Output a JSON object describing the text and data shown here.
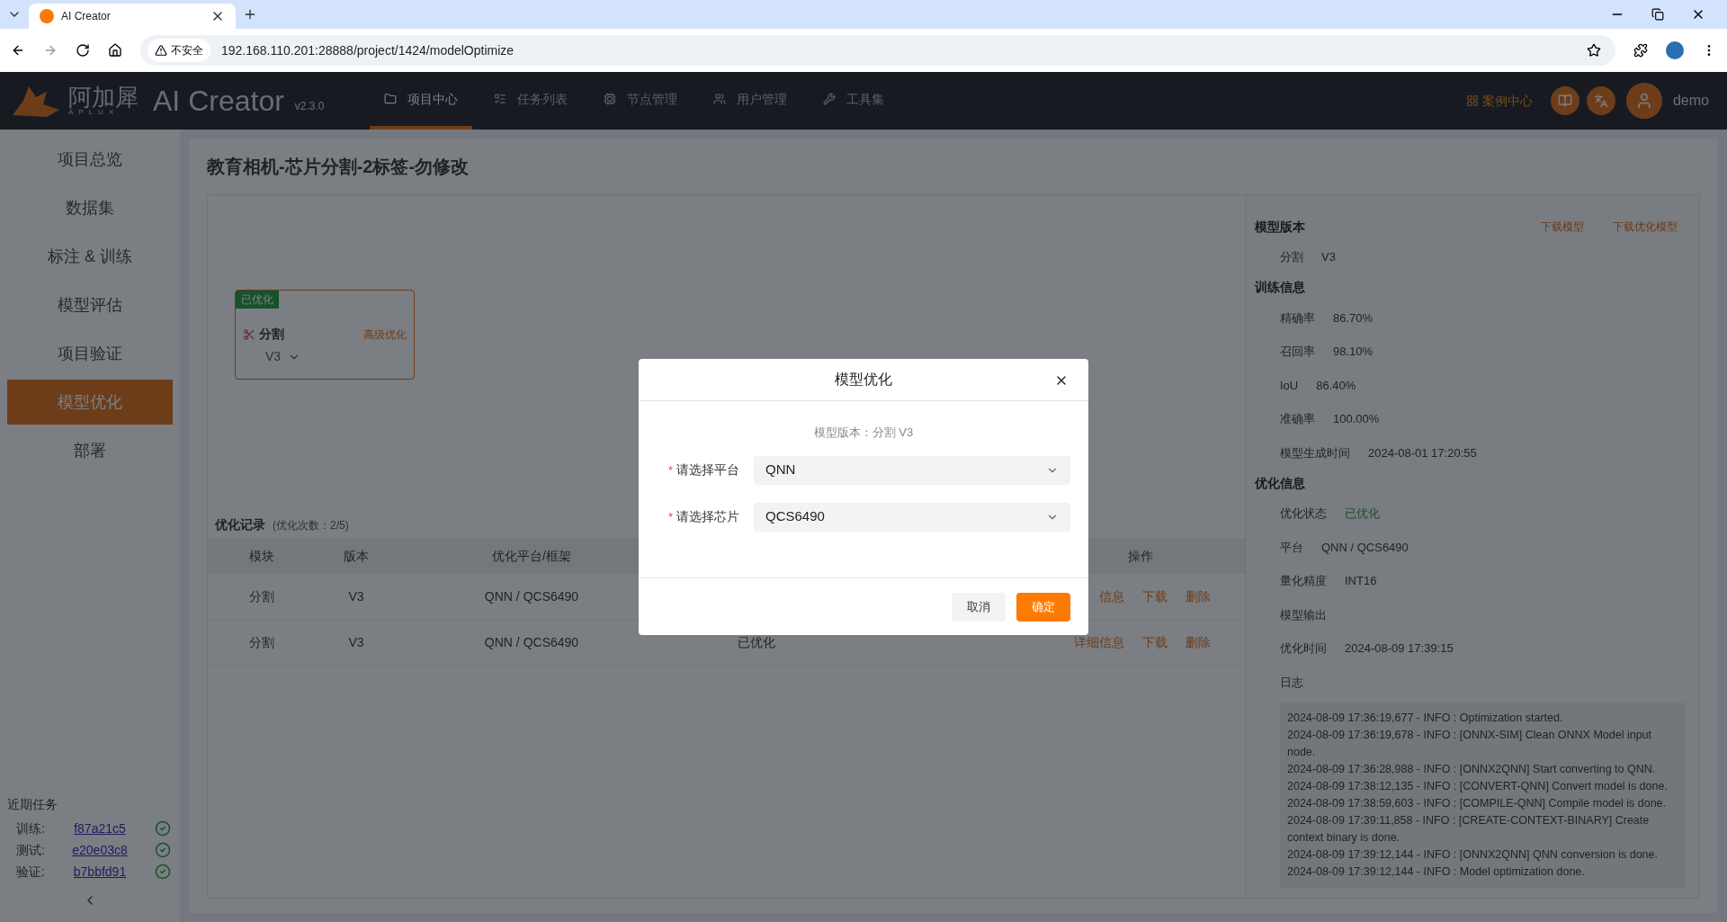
{
  "browser": {
    "tab_title": "AI Creator",
    "security_label": "不安全",
    "url": "192.168.110.201:28888/project/1424/modelOptimize"
  },
  "header": {
    "logo_text": "阿加犀",
    "logo_sub": "APLUX",
    "app_name": "AI Creator",
    "version": "v2.3.0",
    "nav": [
      {
        "label": "项目中心",
        "selected": true
      },
      {
        "label": "任务列表",
        "selected": false
      },
      {
        "label": "节点管理",
        "selected": false
      },
      {
        "label": "用户管理",
        "selected": false
      },
      {
        "label": "工具集",
        "selected": false
      }
    ],
    "case_center": "案例中心",
    "user": "demo"
  },
  "sidebar": {
    "items": [
      {
        "label": "项目总览",
        "selected": false
      },
      {
        "label": "数据集",
        "selected": false
      },
      {
        "label": "标注 & 训练",
        "selected": false
      },
      {
        "label": "模型评估",
        "selected": false
      },
      {
        "label": "项目验证",
        "selected": false
      },
      {
        "label": "模型优化",
        "selected": true
      },
      {
        "label": "部署",
        "selected": false
      }
    ],
    "recent_tasks": {
      "title": "近期任务",
      "items": [
        {
          "label": "训练:",
          "id": "f87a21c5",
          "kind": "success"
        },
        {
          "label": "测试:",
          "id": "e20e03c8",
          "kind": "success"
        },
        {
          "label": "验证:",
          "id": "b7bbfd91",
          "kind": "success"
        }
      ]
    }
  },
  "page": {
    "title": "教育相机-芯片分割-2标签-勿修改"
  },
  "node": {
    "badge": "已优化",
    "name": "分割",
    "version": "V3",
    "action": "高级优化"
  },
  "records": {
    "title": "优化记录",
    "count": "(优化次数：2/5)",
    "columns": [
      "模块",
      "版本",
      "优化平台/框架",
      "操作"
    ],
    "rows": [
      {
        "module": "分割",
        "version": "V3",
        "platform": "QNN / QCS6490",
        "actions": [
          "信息",
          "下载",
          "删除"
        ]
      },
      {
        "module": "分割",
        "version": "V3",
        "platform": "QNN / QCS6490",
        "status": "已优化",
        "actions": [
          "详细信息",
          "下载",
          "删除"
        ]
      }
    ]
  },
  "details": {
    "sections": [
      {
        "title": "模型版本",
        "links": [
          "下载模型",
          "下载优化模型"
        ],
        "rows": [
          {
            "label": "分割",
            "value": "V3"
          }
        ]
      },
      {
        "title": "训练信息",
        "rows": [
          {
            "label": "精确率",
            "value": "86.70%"
          },
          {
            "label": "召回率",
            "value": "98.10%"
          },
          {
            "label": "IoU",
            "value": "86.40%"
          },
          {
            "label": "准确率",
            "value": "100.00%"
          },
          {
            "label": "模型生成时间",
            "value": "2024-08-01 17:20:55"
          }
        ]
      },
      {
        "title": "优化信息",
        "rows": [
          {
            "label": "优化状态",
            "value": "已优化",
            "kind": "success"
          },
          {
            "label": "平台",
            "value": "QNN / QCS6490"
          },
          {
            "label": "量化精度",
            "value": "INT16"
          },
          {
            "label": "模型输出"
          },
          {
            "label": "优化时间",
            "value": "2024-08-09 17:39:15"
          },
          {
            "label": "日志"
          }
        ]
      }
    ],
    "log": [
      "2024-08-09 17:36:19,677 - INFO : Optimization started.",
      "2024-08-09 17:36:19,678 - INFO : [ONNX-SIM] Clean ONNX Model input node.",
      "2024-08-09 17:36:28,988 - INFO : [ONNX2QNN] Start converting to QNN.",
      "2024-08-09 17:38:12,135 - INFO : [CONVERT-QNN] Convert model is done.",
      "2024-08-09 17:38:59,603 - INFO : [COMPILE-QNN] Compile model is done.",
      "2024-08-09 17:39:11,858 - INFO : [CREATE-CONTEXT-BINARY] Create context binary is done.",
      "2024-08-09 17:39:12,144 - INFO : [ONNX2QNN] QNN conversion is done.",
      "2024-08-09 17:39:12,144 - INFO : Model optimization done."
    ]
  },
  "modal": {
    "title": "模型优化",
    "version_line": "模型版本：分割 V3",
    "required_mark": "*",
    "fields": [
      {
        "label": "请选择平台",
        "value": "QNN",
        "required": true
      },
      {
        "label": "请选择芯片",
        "value": "QCS6490",
        "required": true
      }
    ],
    "buttons": [
      {
        "label": "取消",
        "kind": "secondary"
      },
      {
        "label": "确定",
        "kind": "primary"
      }
    ]
  }
}
